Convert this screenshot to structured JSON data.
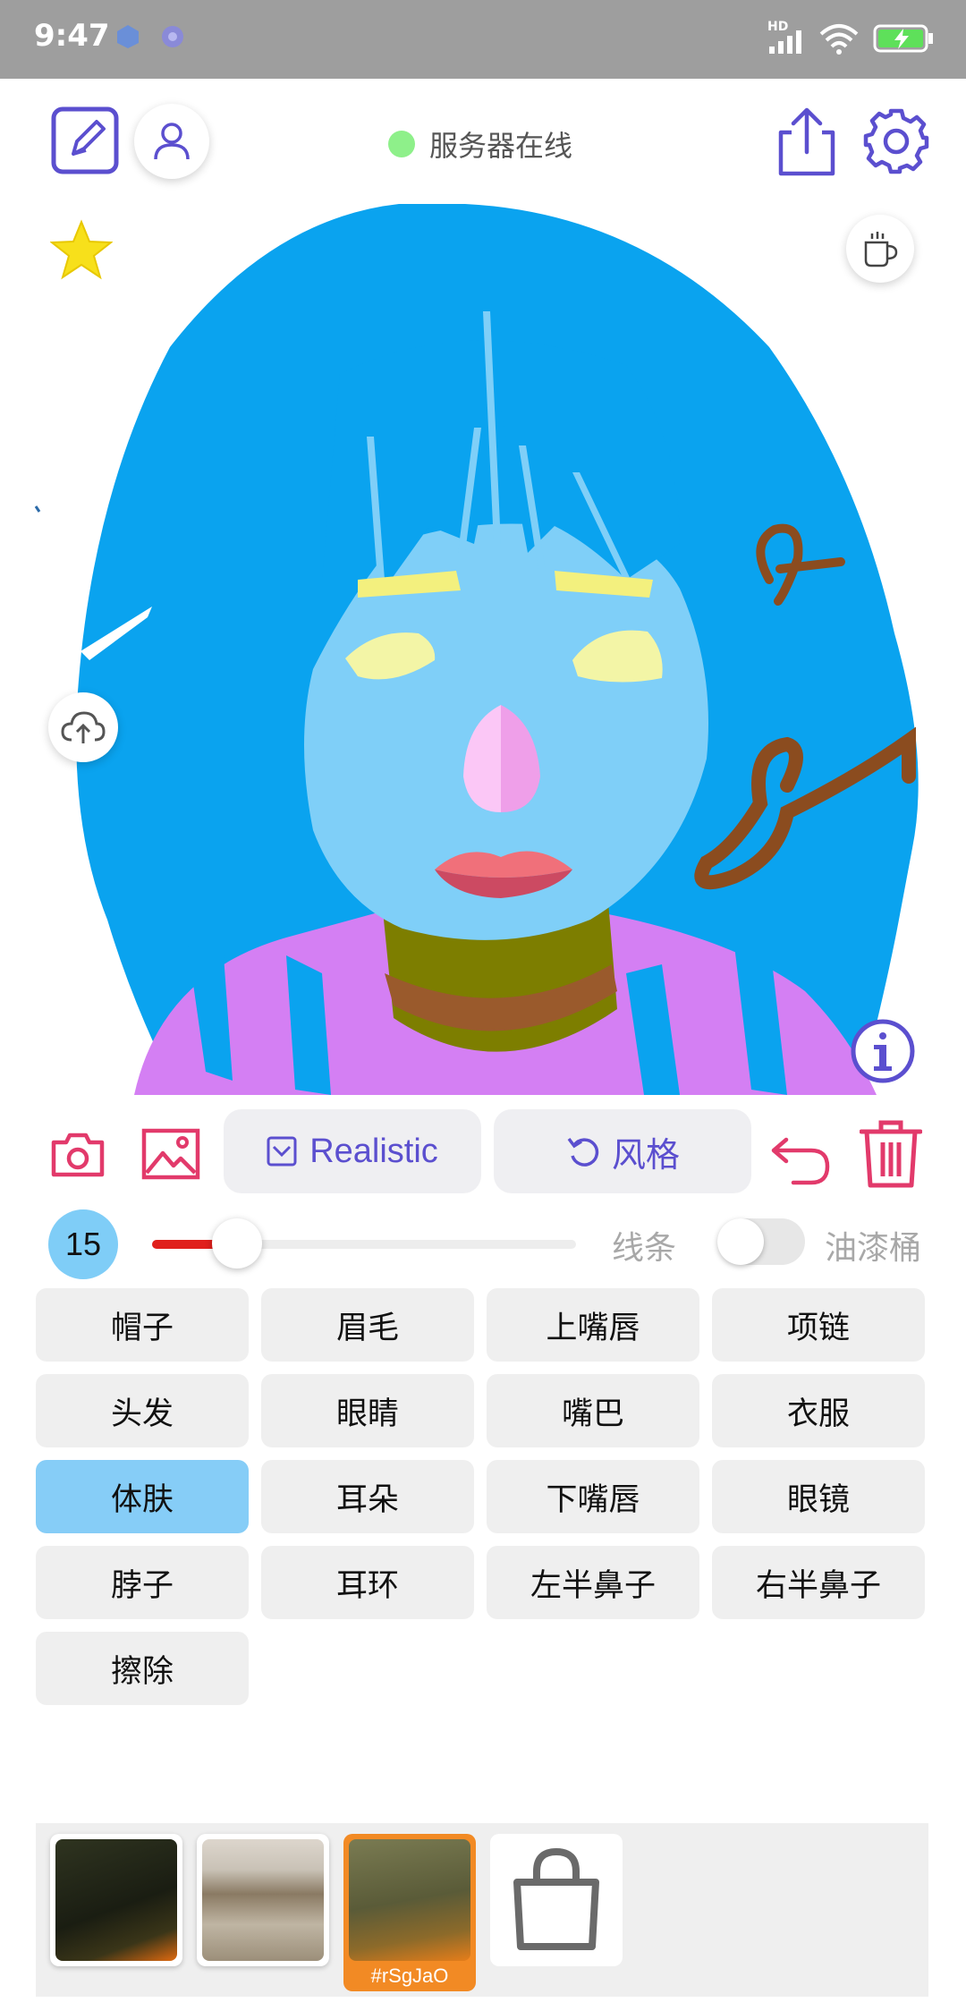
{
  "status_bar": {
    "time": "9:47",
    "network_label": "HD",
    "icons": [
      "app-notification-icon",
      "app-notification-icon",
      "signal-icon",
      "wifi-icon",
      "battery-charging-icon"
    ]
  },
  "header": {
    "server_status": "服务器在线",
    "status_color": "#8ef08a",
    "accent": "#5b4fcf",
    "icons": [
      "edit-pad-icon",
      "user-icon",
      "share-icon",
      "gear-icon"
    ]
  },
  "canvas": {
    "corner_icons": [
      "star-icon",
      "coffee-cup-icon",
      "cloud-upload-icon",
      "info-icon"
    ]
  },
  "toolbar": {
    "model_button": "Realistic",
    "style_button": "风格",
    "icons": [
      "camera-icon",
      "image-icon",
      "undo-icon",
      "trash-icon"
    ],
    "danger_color": "#e23a6b"
  },
  "brush": {
    "size": "15",
    "level": 0.2,
    "mode_label": "线条",
    "bucket_label": "油漆桶",
    "bucket_enabled": false
  },
  "categories": [
    {
      "label": "帽子",
      "active": false
    },
    {
      "label": "眉毛",
      "active": false
    },
    {
      "label": "上嘴唇",
      "active": false
    },
    {
      "label": "项链",
      "active": false
    },
    {
      "label": "头发",
      "active": false
    },
    {
      "label": "眼睛",
      "active": false
    },
    {
      "label": "嘴巴",
      "active": false
    },
    {
      "label": "衣服",
      "active": false
    },
    {
      "label": "体肤",
      "active": true
    },
    {
      "label": "耳朵",
      "active": false
    },
    {
      "label": "下嘴唇",
      "active": false
    },
    {
      "label": "眼镜",
      "active": false
    },
    {
      "label": "脖子",
      "active": false
    },
    {
      "label": "耳环",
      "active": false
    },
    {
      "label": "左半鼻子",
      "active": false
    },
    {
      "label": "右半鼻子",
      "active": false
    },
    {
      "label": "擦除",
      "active": false
    }
  ],
  "results": {
    "selected_tag": "#rSgJaO",
    "shop_icon": "shopping-bag-icon"
  }
}
